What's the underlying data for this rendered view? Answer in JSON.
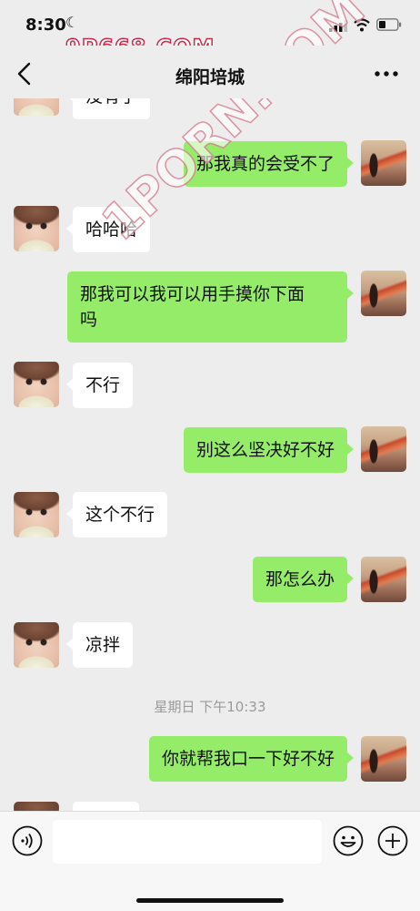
{
  "status_bar": {
    "time": "8:30",
    "moon": "☾"
  },
  "watermarks": {
    "top": "9P668.COM",
    "diagonal": "1PORN.COM"
  },
  "nav": {
    "title": "绵阳培城"
  },
  "messages": [
    {
      "side": "in",
      "text": "没有了"
    },
    {
      "side": "out",
      "text": "那我真的会受不了"
    },
    {
      "side": "in",
      "text": "哈哈哈"
    },
    {
      "side": "out",
      "text": "那我可以我可以用手摸你下面\n吗"
    },
    {
      "side": "in",
      "text": "不行"
    },
    {
      "side": "out",
      "text": "别这么坚决好不好"
    },
    {
      "side": "in",
      "text": "这个不行"
    },
    {
      "side": "out",
      "text": "那怎么办"
    },
    {
      "side": "in",
      "text": "凉拌"
    },
    {
      "side": "out",
      "text": "你就帮我口一下好不好"
    }
  ],
  "timestamp": "星期日 下午10:33",
  "colors": {
    "outgoing_bubble": "#95ec69",
    "incoming_bubble": "#ffffff",
    "background": "#ededed"
  }
}
